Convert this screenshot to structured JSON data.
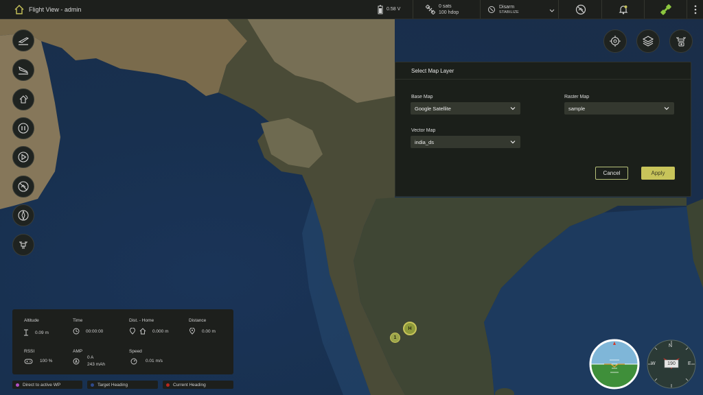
{
  "app": {
    "title": "Flight View - admin"
  },
  "topbar": {
    "battery_voltage": "0.58 V",
    "gps_sats": "0 sats",
    "gps_hdop": "100 hdop",
    "arm_state": "Disarm",
    "flight_mode": "STABILIZE"
  },
  "left_tools": [
    {
      "name": "takeoff-button",
      "icon": "takeoff-icon"
    },
    {
      "name": "land-button",
      "icon": "land-icon"
    },
    {
      "name": "return-home-button",
      "icon": "return-icon"
    },
    {
      "name": "pause-button",
      "icon": "pause-icon"
    },
    {
      "name": "play-button",
      "icon": "play-icon"
    },
    {
      "name": "disable-button",
      "icon": "no-fly-icon"
    },
    {
      "name": "compass-button",
      "icon": "compass-icon"
    },
    {
      "name": "drone-button",
      "icon": "drone-icon"
    }
  ],
  "dialog": {
    "title": "Select Map Layer",
    "base_map": {
      "label": "Base Map",
      "value": "Google Satellite"
    },
    "raster_map": {
      "label": "Raster Map",
      "value": "sample"
    },
    "vector_map": {
      "label": "Vector Map",
      "value": "india_ds"
    },
    "cancel_label": "Cancel",
    "apply_label": "Apply"
  },
  "telemetry": {
    "altitude": {
      "label": "Altitude",
      "value": "0.09 m"
    },
    "time": {
      "label": "Time",
      "value": "00:00:00"
    },
    "dist_home": {
      "label": "Dist. - Home",
      "value": "0.000 m"
    },
    "distance": {
      "label": "Distance",
      "value": "0.00 m"
    },
    "rssi": {
      "label": "RSSI",
      "value": "100 %"
    },
    "amp": {
      "label": "AMP",
      "value": "0 A",
      "value2": "243 mAh"
    },
    "speed": {
      "label": "Speed",
      "value": "0.01 m/s"
    }
  },
  "legend": {
    "direct": {
      "label": "Direct to active WP",
      "color": "#b04fc4"
    },
    "target": {
      "label": "Target Heading",
      "color": "#2f4a8c"
    },
    "current": {
      "label": "Current Heading",
      "color": "#b8281e"
    }
  },
  "markers": {
    "home": "H",
    "waypoint": "1"
  },
  "compass": {
    "heading": "190",
    "n": "N",
    "e": "E",
    "w": "W"
  },
  "colors": {
    "accent": "#c8c45a",
    "panel": "#1d1f1c",
    "ocean": "#1a3458",
    "land": "#5d5a43"
  }
}
